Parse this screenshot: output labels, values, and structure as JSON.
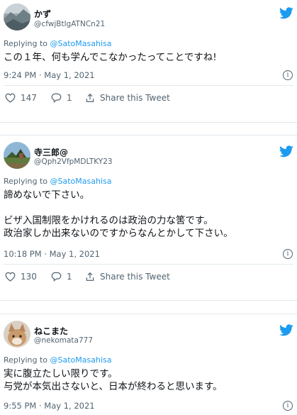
{
  "tweets": [
    {
      "name": "かず",
      "handle": "@cfwjBtlgATNCn21",
      "replying_prefix": "Replying to ",
      "replying_to": "@SatoMasahisa",
      "text": "この１年、何も学んでこなかったってことですね!",
      "timestamp": "9:24 PM · May 1, 2021",
      "likes": "147",
      "replies": "1",
      "share_label": "Share this Tweet"
    },
    {
      "name": "寺三郎@",
      "handle": "@Qph2VfpMDLTKY23",
      "replying_prefix": "Replying to ",
      "replying_to": "@SatoMasahisa",
      "text": "諦めないで下さい。\n\nビザ入国制限をかけれるのは政治の力な筈です。\n政治家しか出来ないのですからなんとかして下さい。",
      "timestamp": "10:18 PM · May 1, 2021",
      "likes": "130",
      "replies": "1",
      "share_label": "Share this Tweet"
    },
    {
      "name": "ねこまた",
      "handle": "@nekomata777",
      "replying_prefix": "Replying to ",
      "replying_to": "@SatoMasahisa",
      "text": "実に腹立たしい限りです。\n与党が本気出さないと、日本が終わると思います。",
      "timestamp": "9:55 PM · May 1, 2021"
    }
  ],
  "colors": {
    "twitter_blue": "#1d9bf0",
    "secondary_text": "#536471",
    "divider": "#e1e8ed"
  },
  "icons": [
    "twitter-bird-icon",
    "heart-icon",
    "reply-icon",
    "share-icon",
    "info-icon"
  ]
}
